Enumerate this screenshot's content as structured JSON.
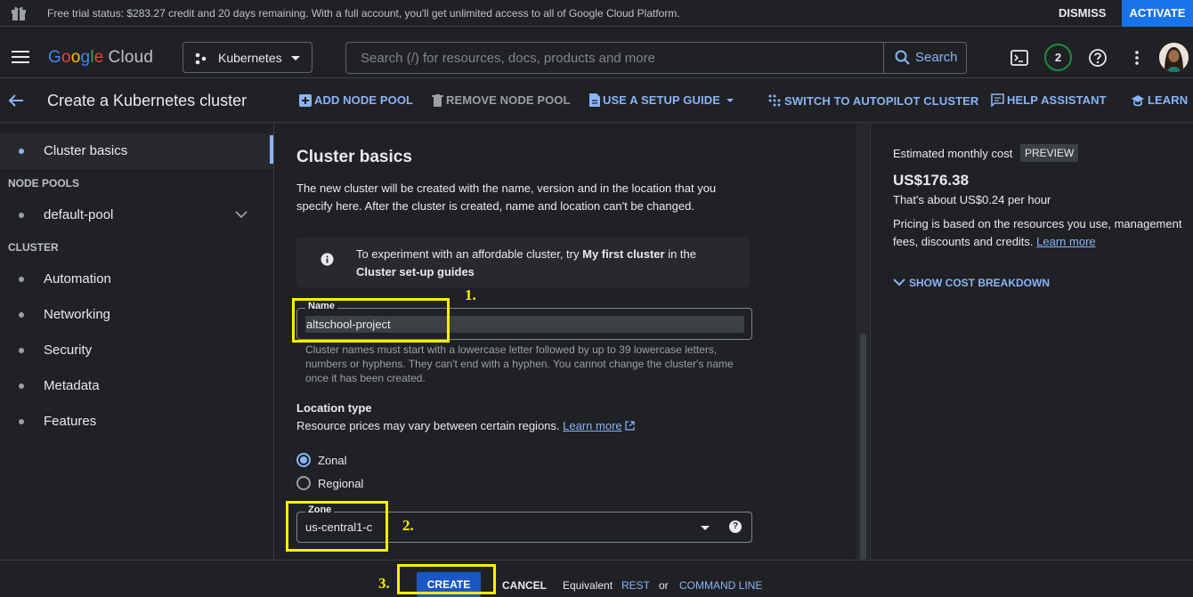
{
  "trial_banner": {
    "message": "Free trial status: $283.27 credit and 20 days remaining. With a full account, you'll get unlimited access to all of Google Cloud Platform.",
    "dismiss_label": "DISMISS",
    "activate_label": "ACTIVATE"
  },
  "topbar": {
    "logo_g": "G",
    "logo_o1": "o",
    "logo_o2": "o",
    "logo_g2": "g",
    "logo_l": "l",
    "logo_e": "e",
    "logo_cloud": "Cloud",
    "product": "Kubernetes",
    "search_placeholder": "Search (/) for resources, docs, products and more",
    "search_button": "Search",
    "notifications_count": "2"
  },
  "page_header": {
    "title": "Create a Kubernetes cluster",
    "actions": {
      "add_node_pool": "ADD NODE POOL",
      "remove_node_pool": "REMOVE NODE POOL",
      "setup_guide": "USE A SETUP GUIDE",
      "autopilot": "SWITCH TO AUTOPILOT CLUSTER",
      "help_assistant": "HELP ASSISTANT",
      "learn": "LEARN"
    }
  },
  "sidebar": {
    "cluster_basics": "Cluster basics",
    "node_pools_header": "NODE POOLS",
    "default_pool": "default-pool",
    "cluster_header": "CLUSTER",
    "items": [
      "Automation",
      "Networking",
      "Security",
      "Metadata",
      "Features"
    ]
  },
  "main": {
    "heading": "Cluster basics",
    "description": "The new cluster will be created with the name, version and in the location that you specify here. After the cluster is created, name and location can't be changed.",
    "info_pre": "To experiment with an affordable cluster, try ",
    "info_bold1": "My first cluster",
    "info_mid": " in the ",
    "info_bold2": "Cluster set-up guides",
    "name_label": "Name",
    "name_value": "altschool-project",
    "name_hint": "Cluster names must start with a lowercase letter followed by up to 39 lowercase letters, numbers or hyphens. They can't end with a hyphen. You cannot change the cluster's name once it has been created.",
    "location_type_label": "Location type",
    "location_desc": "Resource prices may vary between certain regions.",
    "learn_more": "Learn more",
    "radio_zonal": "Zonal",
    "radio_regional": "Regional",
    "selected_location_type": "Zonal",
    "zone_label": "Zone",
    "zone_value": "us-central1-c"
  },
  "cost_panel": {
    "label": "Estimated monthly cost",
    "badge": "PREVIEW",
    "price": "US$176.38",
    "per_hour": "That's about US$0.24 per hour",
    "pricing_text": "Pricing is based on the resources you use, management fees, discounts and credits.",
    "learn_more": "Learn more",
    "breakdown": "SHOW COST BREAKDOWN"
  },
  "footer": {
    "create": "CREATE",
    "cancel": "CANCEL",
    "equivalent": "Equivalent",
    "rest": "REST",
    "or": "or",
    "command_line": "COMMAND LINE"
  },
  "annotations": {
    "step1": "1.",
    "step2": "2.",
    "step3": "3."
  },
  "colors": {
    "background": "#202124",
    "accent": "#8ab4f8",
    "primary_button": "#1a73e8",
    "highlight": "#ffef00"
  }
}
